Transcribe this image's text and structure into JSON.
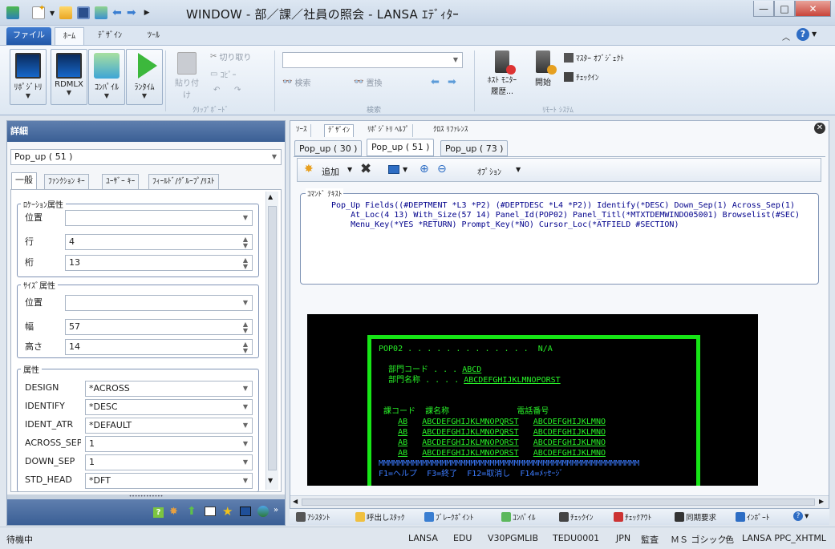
{
  "window": {
    "title": "WINDOW - 部／課／社員の照会  - LANSA ｴﾃﾞｨﾀｰ"
  },
  "ribbon_tabs": [
    "ファイル",
    "ﾎｰﾑ",
    "ﾃﾞｻﾞｲﾝ",
    "ﾂｰﾙ"
  ],
  "ribbon": {
    "repository": "ﾘﾎﾟｼﾞﾄﾘ",
    "rdmlx": "RDMLX",
    "compile": "ｺﾝﾊﾟｲﾙ",
    "runtime": "ﾗﾝﾀｲﾑ",
    "paste": "貼り付け",
    "cut": "切り取り",
    "copy": "ｺﾋﾟｰ",
    "clipboard_group": "ｸﾘｯﾌﾟﾎﾞｰﾄﾞ",
    "search": "検索",
    "replace": "置換",
    "search_group": "検索",
    "host_monitor_1": "ﾎｽﾄ ﾓﾆﾀｰ",
    "host_monitor_2": "履歴...",
    "start": "開始",
    "master_object": "ﾏｽﾀｰ ｵﾌﾞｼﾞｪｸﾄ",
    "checkin": "ﾁｪｯｸｲﾝ",
    "remote_group": "ﾘﾓｰﾄ ｼｽﾃﾑ"
  },
  "details": {
    "header": "詳細",
    "selector": "Pop_up ( 51 )",
    "tabs": [
      "一般",
      "ﾌｧﾝｸｼｮﾝ ｷｰ",
      "ﾕｰｻﾞｰ ｷｰ",
      "ﾌｨｰﾙﾄﾞ/ｸﾞﾙｰﾌﾟ/ﾘｽﾄ"
    ],
    "location": {
      "title": "ﾛｹｰｼｮﾝ属性",
      "pos_label": "位置",
      "pos_value": "",
      "row_label": "行",
      "row_value": "4",
      "col_label": "桁",
      "col_value": "13"
    },
    "size": {
      "title": "ｻｲｽﾞ属性",
      "pos_label": "位置",
      "pos_value": "",
      "width_label": "幅",
      "width_value": "57",
      "height_label": "高さ",
      "height_value": "14"
    },
    "attrs": {
      "title": "属性",
      "items": [
        {
          "label": "DESIGN",
          "value": "*ACROSS"
        },
        {
          "label": "IDENTIFY",
          "value": "*DESC"
        },
        {
          "label": "IDENT_ATR",
          "value": "*DEFAULT"
        },
        {
          "label": "ACROSS_SEP",
          "value": "1"
        },
        {
          "label": "DOWN_SEP",
          "value": "1"
        },
        {
          "label": "STD_HEAD",
          "value": "*DFT"
        }
      ]
    }
  },
  "editor": {
    "top_tabs": [
      "ｿｰｽ",
      "ﾃﾞｻﾞｲﾝ",
      "ﾘﾎﾟｼﾞﾄﾘ ﾍﾙﾌﾟ",
      "ｸﾛｽ ﾘﾌｧﾚﾝｽ"
    ],
    "doc_tabs": [
      "Pop_up ( 30 )",
      "Pop_up ( 51 )",
      "Pop_up ( 73 )"
    ],
    "add_label": "追加",
    "option_label": "ｵﾌﾟｼｮﾝ",
    "command_title": "ｺﾏﾝﾄﾞ ﾃｷｽﾄ",
    "command_lines": [
      "Pop_Up Fields((#DEPTMENT *L3 *P2) (#DEPTDESC *L4 *P2)) Identify(*DESC) Down_Sep(1) Across_Sep(1)",
      "    At_Loc(4 13) With_Size(57 14) Panel_Id(POP02) Panel_Titl(*MTXTDEMWINDO05001) Browselist(#SEC)",
      "    Menu_Key(*YES *RETURN) Prompt_Key(*NO) Cursor_Loc(*ATFIELD #SECTION)"
    ],
    "screen": {
      "line1a": "POP02 . . . . . . . . . . . . .",
      "line1b": "N/A",
      "dept_code_label": "部門コード . . .",
      "dept_code_value": "ABCD",
      "dept_name_label": "部門名称 . . . .",
      "dept_name_value": "ABCDEFGHIJKLMNOPORST",
      "col_header_1": "課コード",
      "col_header_2": "課名称",
      "col_header_3": "電話番号",
      "rows": [
        {
          "code": "AB",
          "name": "ABCDEFGHIJKLMNOPQRST",
          "phone": "ABCDEFGHIJKLMNO"
        },
        {
          "code": "AB",
          "name": "ABCDEFGHIJKLMNOPQRST",
          "phone": "ABCDEFGHIJKLMNO"
        },
        {
          "code": "AB",
          "name": "ABCDEFGHIJKLMNOPORST",
          "phone": "ABCDEFGHIJKLMNO"
        },
        {
          "code": "AB",
          "name": "ABCDEFGHIJKLMNOPORST",
          "phone": "ABCDEFGHIJKLMNO"
        }
      ],
      "msg_bar": "MMMMMMMMMMMMMMMMMMMMMMMMMMMMMMMMMMMMMMMMMMMMMMMMMMMMMM",
      "fkeys": "F1=ヘルプ  F3=終了  F12=取消し  F14=ﾒｯｾｰｼﾞ"
    }
  },
  "bottom_tools": [
    "ｱｼｽﾀﾝﾄ",
    "呼出しｽﾀｯｸ",
    "ﾌﾞﾚｰｸﾎﾟｲﾝﾄ",
    "ｺﾝﾊﾟｲﾙ",
    "ﾁｪｯｸｲﾝ",
    "ﾁｪｯｸｱｳﾄ",
    "同期要求",
    "ｲﾝﾎﾟｰﾄ"
  ],
  "status": {
    "left": "待機中",
    "items": [
      "LANSA",
      "EDU",
      "V30PGMLIB",
      "TEDU0001",
      "JPN",
      "監査",
      "ＭＳ ゴシック",
      "色",
      "LANSA PPC_XHTML"
    ]
  }
}
